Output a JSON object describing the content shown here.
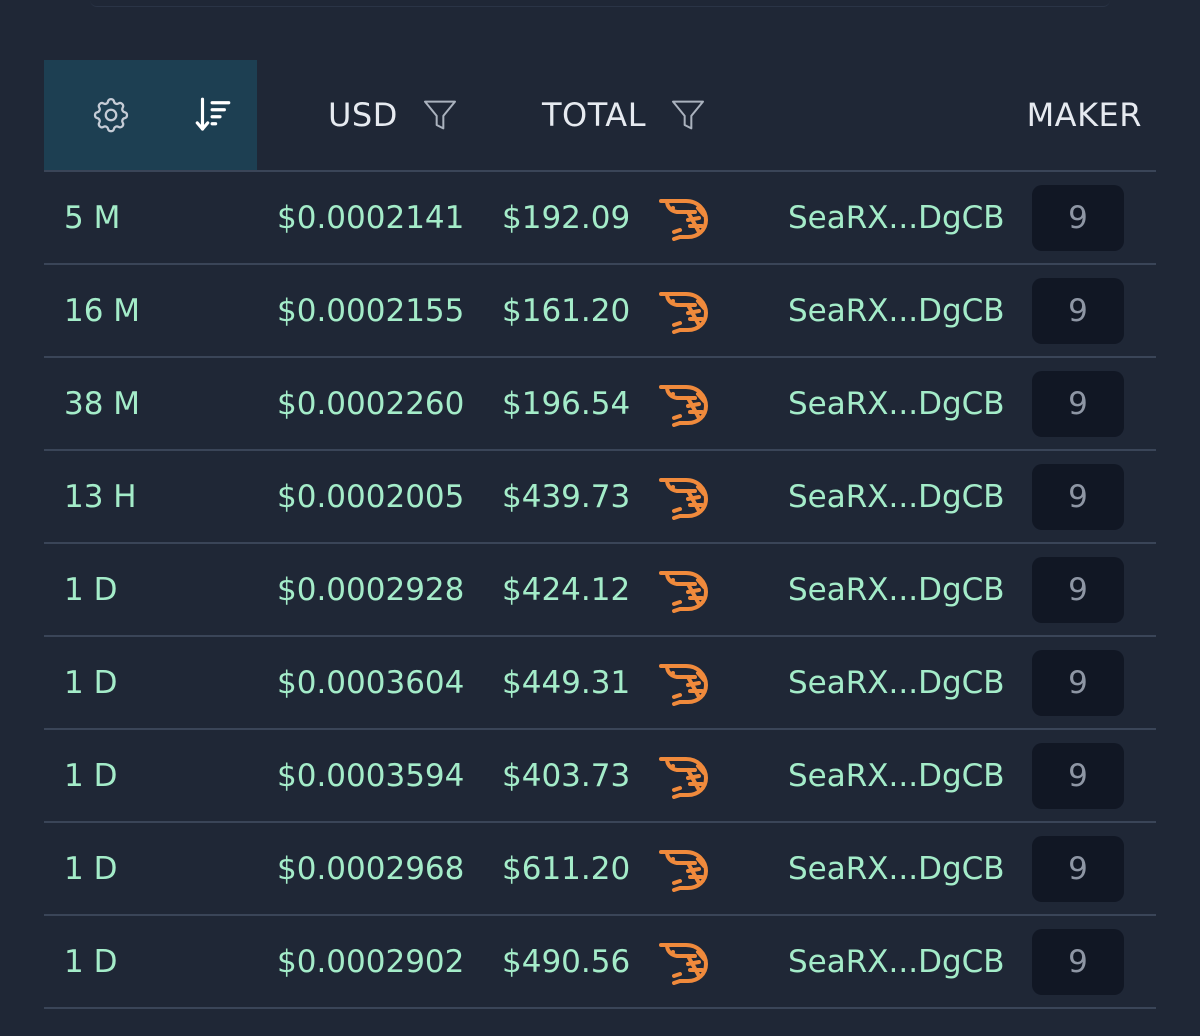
{
  "colors": {
    "background": "#1f2736",
    "header_controls_bg": "#1d3f52",
    "value_green": "#a4ecc9",
    "shrimp_orange": "#f08a3c",
    "badge_bg": "#111724",
    "divider": "#3a4558"
  },
  "header": {
    "icons": [
      "gear-icon",
      "sort-descending-icon"
    ],
    "columns": {
      "usd": "USD",
      "total": "TOTAL",
      "maker": "MAKER"
    }
  },
  "rows": [
    {
      "age": "5 M",
      "usd": "$0.0002141",
      "total": "$192.09",
      "icon": "shrimp-icon",
      "maker": "SeaRX...DgCB",
      "count": "9"
    },
    {
      "age": "16 M",
      "usd": "$0.0002155",
      "total": "$161.20",
      "icon": "shrimp-icon",
      "maker": "SeaRX...DgCB",
      "count": "9"
    },
    {
      "age": "38 M",
      "usd": "$0.0002260",
      "total": "$196.54",
      "icon": "shrimp-icon",
      "maker": "SeaRX...DgCB",
      "count": "9"
    },
    {
      "age": "13 H",
      "usd": "$0.0002005",
      "total": "$439.73",
      "icon": "shrimp-icon",
      "maker": "SeaRX...DgCB",
      "count": "9"
    },
    {
      "age": "1 D",
      "usd": "$0.0002928",
      "total": "$424.12",
      "icon": "shrimp-icon",
      "maker": "SeaRX...DgCB",
      "count": "9"
    },
    {
      "age": "1 D",
      "usd": "$0.0003604",
      "total": "$449.31",
      "icon": "shrimp-icon",
      "maker": "SeaRX...DgCB",
      "count": "9"
    },
    {
      "age": "1 D",
      "usd": "$0.0003594",
      "total": "$403.73",
      "icon": "shrimp-icon",
      "maker": "SeaRX...DgCB",
      "count": "9"
    },
    {
      "age": "1 D",
      "usd": "$0.0002968",
      "total": "$611.20",
      "icon": "shrimp-icon",
      "maker": "SeaRX...DgCB",
      "count": "9"
    },
    {
      "age": "1 D",
      "usd": "$0.0002902",
      "total": "$490.56",
      "icon": "shrimp-icon",
      "maker": "SeaRX...DgCB",
      "count": "9"
    }
  ]
}
